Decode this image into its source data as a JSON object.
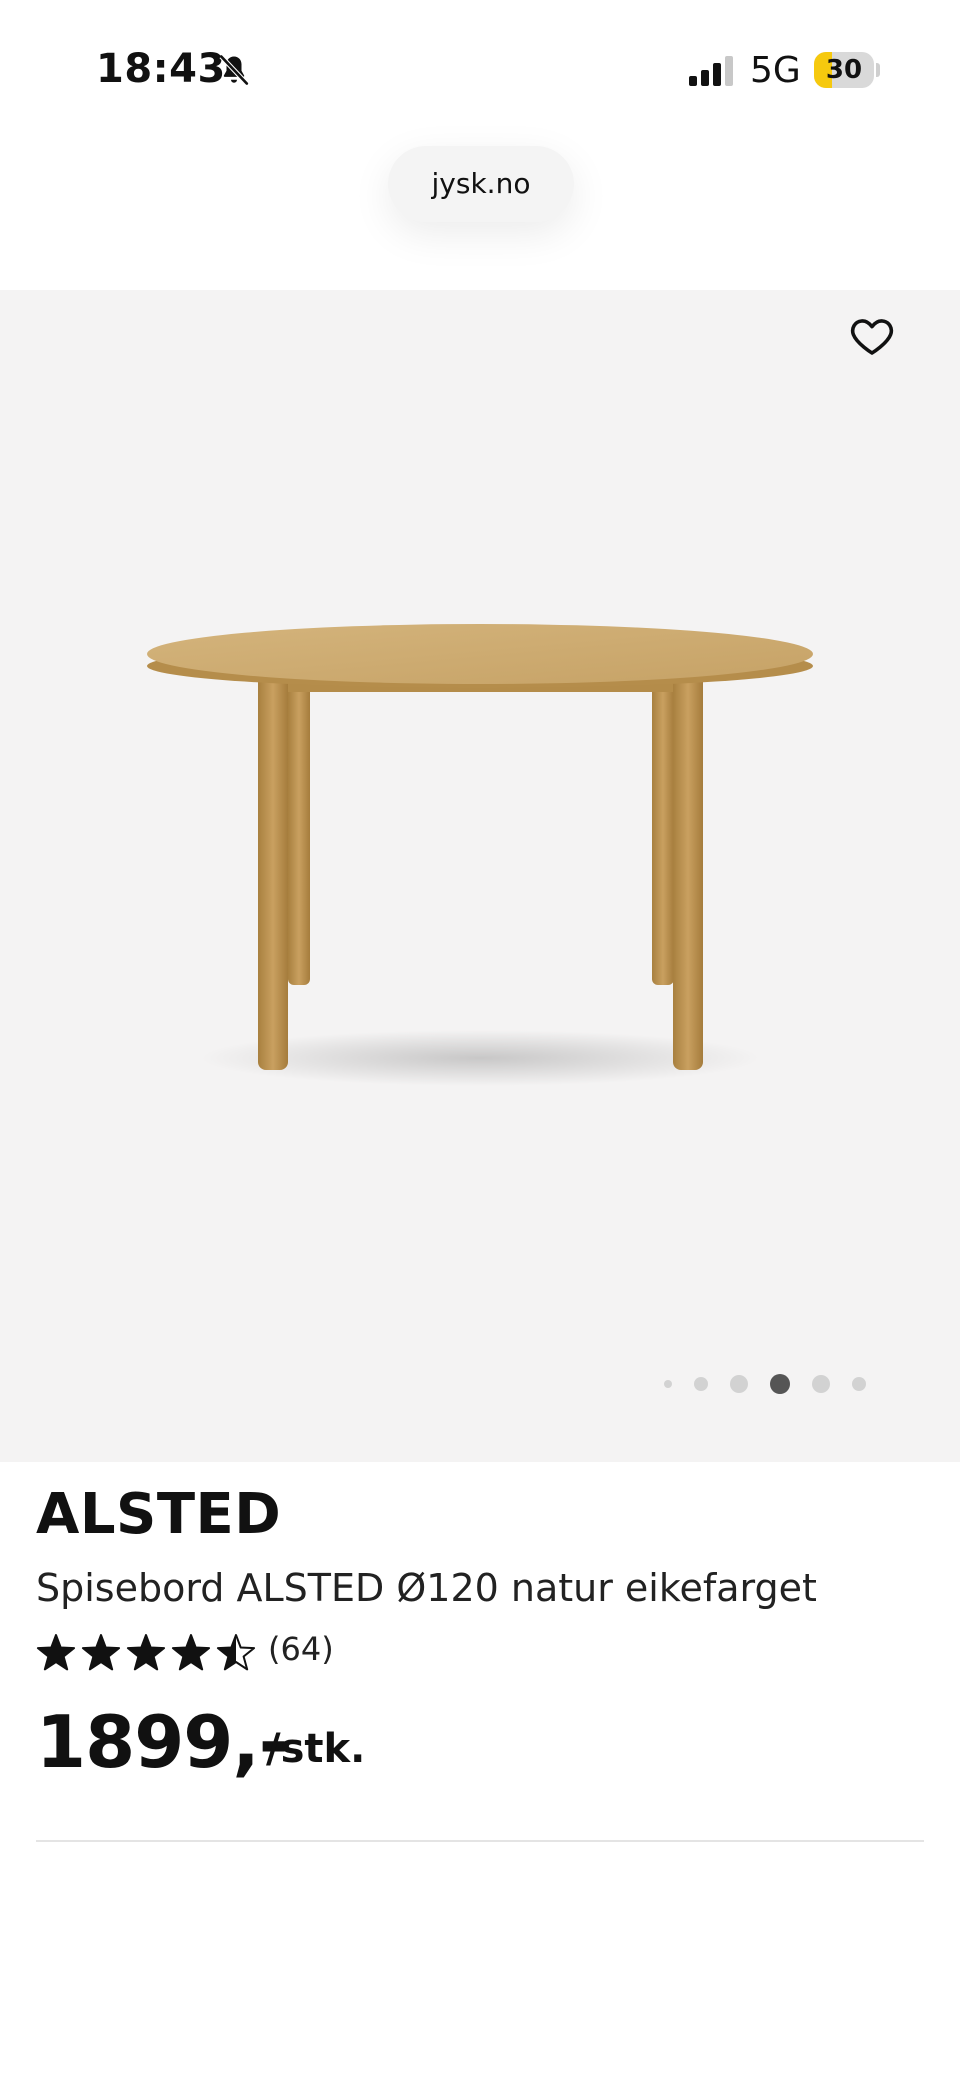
{
  "status_bar": {
    "time": "18:43",
    "network": "5G",
    "battery_level": "30",
    "battery_fraction": 0.3
  },
  "browser": {
    "url": "jysk.no"
  },
  "gallery": {
    "slide_count": 6,
    "active_slide": 4
  },
  "product": {
    "brand": "ALSTED",
    "description": "Spisebord ALSTED Ø120 natur eikefarget",
    "rating": 4.5,
    "rating_count": "(64)",
    "price": "1899,-",
    "unit": "/stk."
  },
  "colors": {
    "accent_battery": "#f6c90e",
    "gallery_bg": "#f4f3f3",
    "wood": "#c9a366"
  },
  "icons": {
    "silent": "bell-slash-icon",
    "signal": "cellular-signal-icon",
    "favorite": "heart-outline-icon"
  }
}
